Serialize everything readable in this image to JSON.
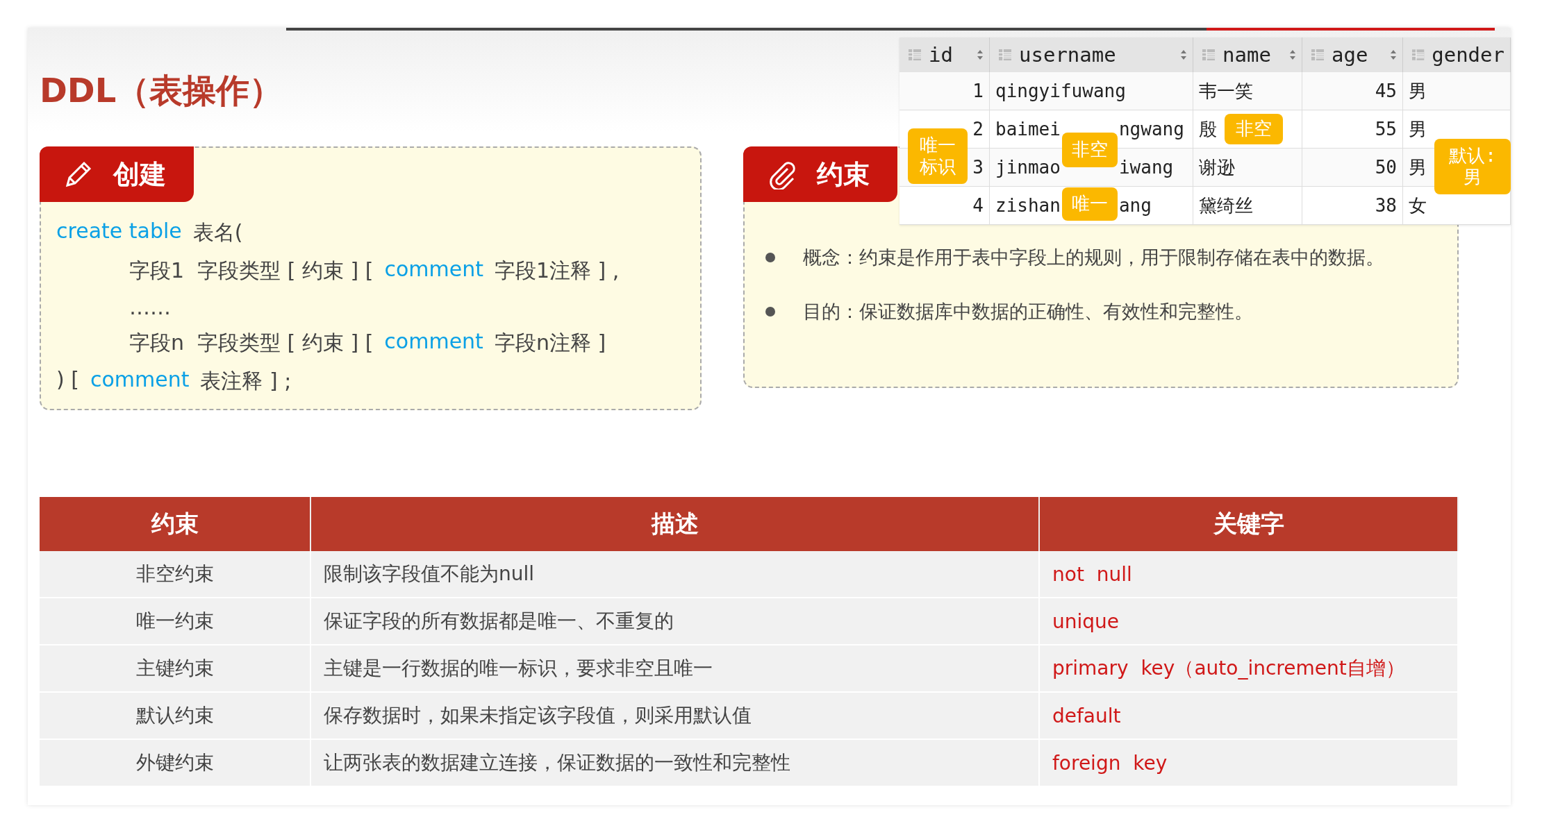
{
  "title": "DDL（表操作）",
  "db_table": {
    "columns": [
      {
        "label": "id",
        "sortable": true
      },
      {
        "label": "username",
        "sortable": true
      },
      {
        "label": "name",
        "sortable": true
      },
      {
        "label": "age",
        "sortable": true
      },
      {
        "label": "gender",
        "sortable": false
      }
    ],
    "rows": [
      {
        "id": "1",
        "username": [
          "qingyifuwang"
        ],
        "name": "韦一笑",
        "age": "45",
        "gender": "男"
      },
      {
        "id": "2",
        "username": [
          "baimei",
          "ngwang"
        ],
        "name": "殷",
        "age": "55",
        "gender": "男"
      },
      {
        "id": "3",
        "username": [
          "jinmao",
          "iwang"
        ],
        "name": "谢逊",
        "age": "50",
        "gender": "男"
      },
      {
        "id": "4",
        "username": [
          "zishan",
          "ang"
        ],
        "name": "黛绮丝",
        "age": "38",
        "gender": "女"
      }
    ],
    "tags": [
      "唯一标识",
      "非空",
      "非空",
      "唯一",
      "默认:男"
    ]
  },
  "create_card": {
    "title": "创建",
    "lines": [
      {
        "indent": false,
        "segments": [
          {
            "kind": "keyword",
            "text": "create table"
          },
          {
            "kind": "text",
            "text": "表名("
          }
        ]
      },
      {
        "indent": true,
        "segments": [
          {
            "kind": "text",
            "text": "字段1  字段类型 [ 约束 ] ["
          },
          {
            "kind": "keyword",
            "text": "comment"
          },
          {
            "kind": "text",
            "text": "字段1注释 ] ,"
          }
        ]
      },
      {
        "indent": true,
        "segments": [
          {
            "kind": "text",
            "text": "……"
          }
        ]
      },
      {
        "indent": true,
        "segments": [
          {
            "kind": "text",
            "text": "字段n  字段类型 [ 约束 ] ["
          },
          {
            "kind": "keyword",
            "text": "comment"
          },
          {
            "kind": "text",
            "text": "字段n注释 ]"
          }
        ]
      },
      {
        "indent": false,
        "segments": [
          {
            "kind": "text",
            "text": ") ["
          },
          {
            "kind": "keyword",
            "text": "comment"
          },
          {
            "kind": "text",
            "text": "表注释 ] ;"
          }
        ]
      }
    ]
  },
  "constraint_card": {
    "title": "约束",
    "bullets": [
      "概念：约束是作用于表中字段上的规则，用于限制存储在表中的数据。",
      "目的：保证数据库中数据的正确性、有效性和完整性。"
    ]
  },
  "constraint_table": {
    "columns": [
      "约束",
      "描述",
      "关键字"
    ],
    "rows": [
      [
        "非空约束",
        "限制该字段值不能为null",
        "not  null"
      ],
      [
        "唯一约束",
        "保证字段的所有数据都是唯一、不重复的",
        "unique"
      ],
      [
        "主键约束",
        "主键是一行数据的唯一标识，要求非空且唯一",
        "primary  key（auto_increment自增）"
      ],
      [
        "默认约束",
        "保存数据时，如果未指定该字段值，则采用默认值",
        "default"
      ],
      [
        "外键约束",
        "让两张表的数据建立连接，保证数据的一致性和完整性",
        "foreign  key"
      ]
    ]
  }
}
